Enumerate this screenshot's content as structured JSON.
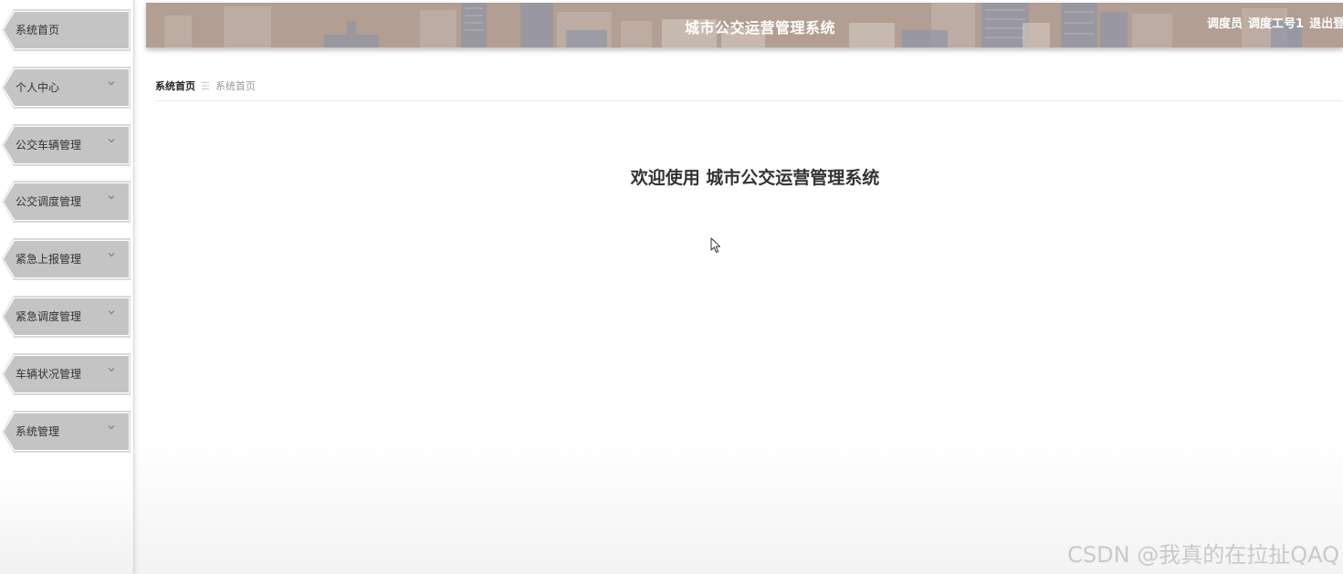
{
  "header": {
    "title": "城市公交运营管理系统",
    "role": "调度员",
    "username": "调度工号1",
    "logout_label": "退出登"
  },
  "sidebar": {
    "items": [
      {
        "label": "系统首页",
        "has_submenu": false
      },
      {
        "label": "个人中心",
        "has_submenu": true
      },
      {
        "label": "公交车辆管理",
        "has_submenu": true
      },
      {
        "label": "公交调度管理",
        "has_submenu": true
      },
      {
        "label": "紧急上报管理",
        "has_submenu": true
      },
      {
        "label": "紧急调度管理",
        "has_submenu": true
      },
      {
        "label": "车辆状况管理",
        "has_submenu": true
      },
      {
        "label": "系统管理",
        "has_submenu": true
      }
    ]
  },
  "breadcrumb": {
    "home": "系统首页",
    "separator": "☰",
    "current": "系统首页"
  },
  "main": {
    "welcome_text": "欢迎使用 城市公交运营管理系统"
  },
  "watermark": "CSDN @我真的在拉扯QAQ",
  "colors": {
    "header_bg": "#b29e92",
    "menu_item_bg": "#c4c4c4",
    "skyline": "#8f96a8"
  },
  "icons": {
    "menu_chevron": "chevron-down-icon",
    "cursor": "mouse-pointer-icon"
  }
}
